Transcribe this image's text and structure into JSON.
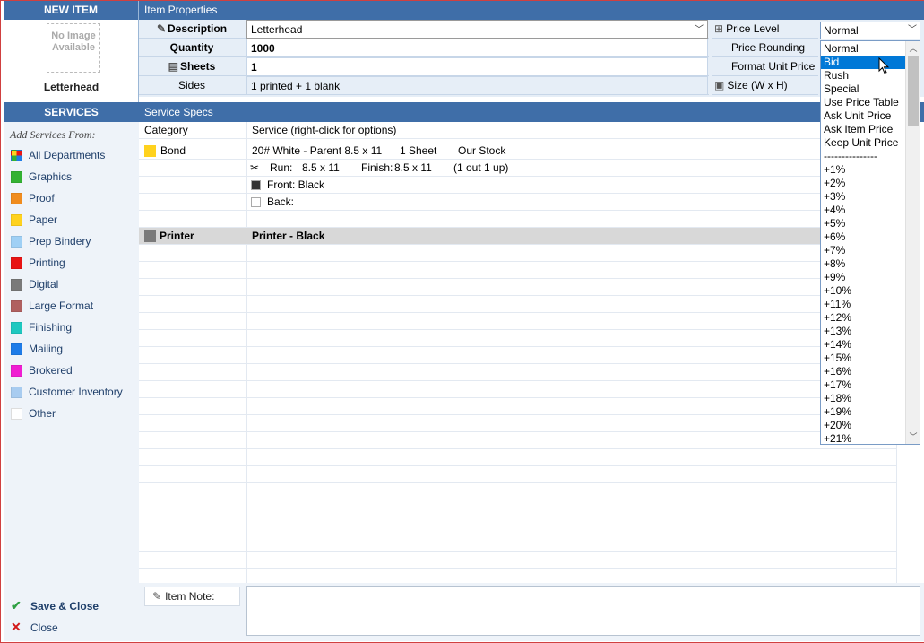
{
  "left_panel": {
    "header": "NEW ITEM",
    "no_image_text": "No Image Available",
    "item_name": "Letterhead",
    "services_header": "SERVICES",
    "add_services_label": "Add Services From:",
    "departments": [
      {
        "label": "All Departments",
        "color": "#multi"
      },
      {
        "label": "Graphics",
        "color": "#33b233"
      },
      {
        "label": "Proof",
        "color": "#f08c1e"
      },
      {
        "label": "Paper",
        "color": "#ffd21e"
      },
      {
        "label": "Prep Bindery",
        "color": "#9fd0f5"
      },
      {
        "label": "Printing",
        "color": "#e81414"
      },
      {
        "label": "Digital",
        "color": "#7a7a7a"
      },
      {
        "label": "Large Format",
        "color": "#b06060"
      },
      {
        "label": "Finishing",
        "color": "#1ec8c0"
      },
      {
        "label": "Mailing",
        "color": "#1e7ce8"
      },
      {
        "label": "Brokered",
        "color": "#f01ed2"
      },
      {
        "label": "Customer Inventory",
        "color": "#a8ccf0"
      },
      {
        "label": "Other",
        "color": "#ffffff"
      }
    ],
    "save_close_label": "Save & Close",
    "close_label": "Close"
  },
  "item_properties": {
    "header": "Item Properties",
    "rows": [
      {
        "label": "Description",
        "value": "Letterhead"
      },
      {
        "label": "Quantity",
        "value": "1000"
      },
      {
        "label": "Sheets",
        "value": "1"
      },
      {
        "label": "Sides",
        "value": "1 printed + 1 blank"
      }
    ],
    "right_labels": [
      "Price Level",
      "Price Rounding",
      "Format Unit Price",
      "Size (W x H)"
    ],
    "price_level_value": "Normal"
  },
  "service_specs": {
    "header": "Service Specs",
    "col_category": "Category",
    "col_service": "Service   (right-click for options)",
    "bond": {
      "category": "Bond",
      "stock_desc": "20# White - Parent 8.5 x 11",
      "sheets": "1 Sheet",
      "stock_source": "Our Stock",
      "run_label": "Run:",
      "run_size": "8.5 x 11",
      "finish_label": "Finish:",
      "finish_size": "8.5 x 11",
      "out_up": "(1 out  1 up)",
      "front": "Front: Black",
      "back": "Back:"
    },
    "printer": {
      "category": "Printer",
      "service": "Printer - Black"
    }
  },
  "item_note_label": "Item Note:",
  "price_level_dropdown": {
    "selected_index": 1,
    "options": [
      "Normal",
      "Bid",
      "Rush",
      "Special",
      "Use Price Table",
      "Ask Unit Price",
      "Ask Item Price",
      "Keep Unit Price",
      "---------------",
      "+1%",
      "+2%",
      "+3%",
      "+4%",
      "+5%",
      "+6%",
      "+7%",
      "+8%",
      "+9%",
      "+10%",
      "+11%",
      "+12%",
      "+13%",
      "+14%",
      "+15%",
      "+16%",
      "+17%",
      "+18%",
      "+19%",
      "+20%",
      "+21%"
    ]
  },
  "colors": {
    "header_blue": "#3f6ea8",
    "panel_bg": "#eef3f9",
    "selection_blue": "#0078d7"
  }
}
